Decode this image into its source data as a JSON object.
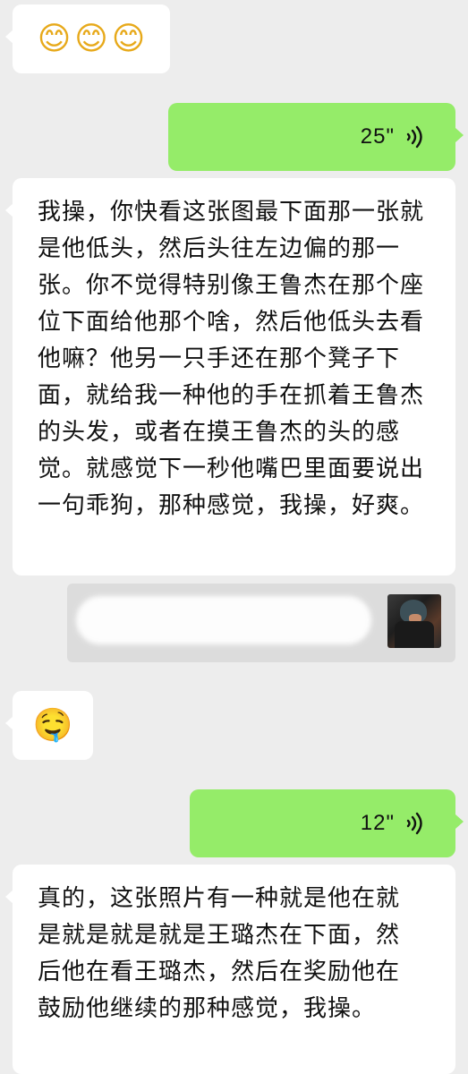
{
  "messages": [
    {
      "kind": "emoji",
      "side": "left",
      "emojis": [
        "😊",
        "😊",
        "😊"
      ]
    },
    {
      "kind": "voice",
      "side": "right",
      "duration": "25\"",
      "icon": "voice-wave-icon"
    },
    {
      "kind": "text",
      "side": "left",
      "text": "我操，你快看这张图最下面那一张就是他低头，然后头往左边偏的那一张。你不觉得特别像王鲁杰在那个座位下面给他那个啥，然后他低头去看他嘛？他另一只手还在那个凳子下面，就给我一种他的手在抓着王鲁杰的头发，或者在摸王鲁杰的头的感觉。就感觉下一秒他嘴巴里面要说出一句乖狗，那种感觉，我操，好爽。"
    },
    {
      "kind": "quote",
      "side": "right",
      "thumbnail": "quoted-photo-thumbnail"
    },
    {
      "kind": "emoji",
      "side": "left",
      "emojis": [
        "🤤"
      ]
    },
    {
      "kind": "voice",
      "side": "right",
      "duration": "12\"",
      "icon": "voice-wave-icon"
    },
    {
      "kind": "text",
      "side": "left",
      "text": "真的，这张照片有一种就是他在就是就是就是就是王璐杰在下面，然后他在看王璐杰，然后在奖励他在鼓励他继续的那种感觉，我操。"
    }
  ],
  "colors": {
    "background": "#ededed",
    "left_bubble": "#ffffff",
    "right_bubble": "#95ec69",
    "quote_bar": "#dcdcdc"
  }
}
